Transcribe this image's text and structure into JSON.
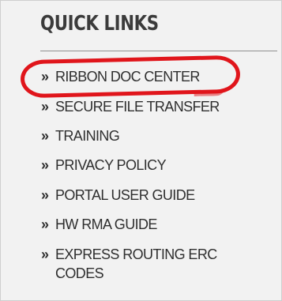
{
  "quick_links": {
    "title": "QUICK LINKS",
    "bullet": "»",
    "items": [
      {
        "label": "RIBBON DOC CENTER"
      },
      {
        "label": "SECURE FILE TRANSFER"
      },
      {
        "label": "TRAINING"
      },
      {
        "label": "PRIVACY POLICY"
      },
      {
        "label": "PORTAL USER GUIDE"
      },
      {
        "label": "HW RMA GUIDE"
      },
      {
        "label": "EXPRESS ROUTING ERC CODES"
      }
    ]
  },
  "colors": {
    "highlight": "#e0151b",
    "panel_background": "#f2f2f2",
    "text": "#2f2f2f"
  }
}
